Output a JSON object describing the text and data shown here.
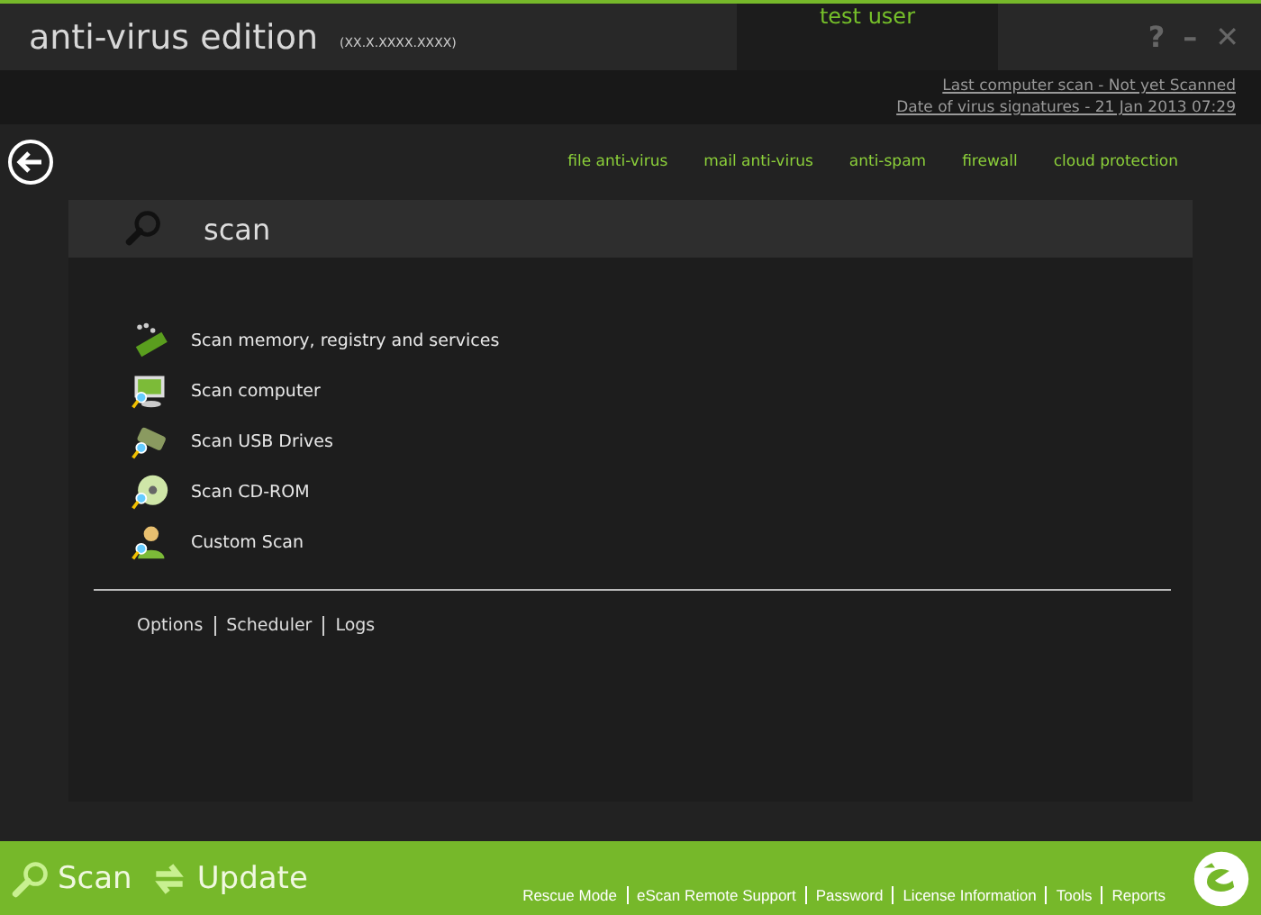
{
  "header": {
    "title": "anti-virus edition",
    "version": "(XX.X.XXXX.XXXX)",
    "user": "test user",
    "help": "?",
    "minimize": "–",
    "close": "✕"
  },
  "status_links": [
    "Last computer scan - Not yet Scanned",
    "Date of  virus signatures - 21 Jan 2013 07:29"
  ],
  "modules": [
    "file anti-virus",
    "mail anti-virus",
    "anti-spam",
    "firewall",
    "cloud protection"
  ],
  "panel": {
    "title": "scan",
    "actions": [
      {
        "kind": "memory",
        "label": "Scan memory, registry and services"
      },
      {
        "kind": "computer",
        "label": "Scan computer"
      },
      {
        "kind": "usb",
        "label": "Scan USB Drives"
      },
      {
        "kind": "cdrom",
        "label": "Scan CD-ROM"
      },
      {
        "kind": "custom",
        "label": "Custom Scan"
      }
    ],
    "links": [
      "Options",
      "Scheduler",
      "Logs"
    ]
  },
  "footer": {
    "buttons": [
      {
        "kind": "scan",
        "label": "Scan"
      },
      {
        "kind": "update",
        "label": "Update"
      }
    ],
    "links": [
      "Rescue Mode",
      "eScan Remote Support",
      "Password",
      "License Information",
      "Tools",
      "Reports"
    ]
  }
}
